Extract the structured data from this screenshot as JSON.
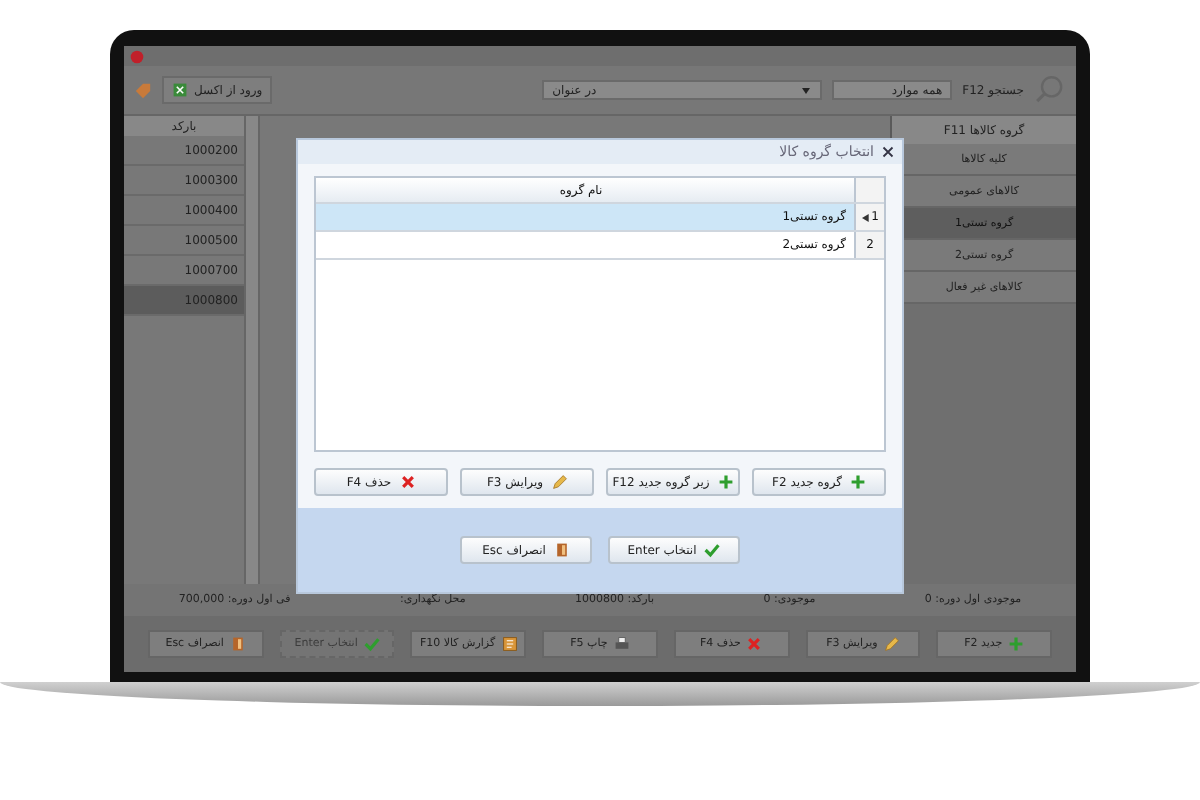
{
  "toolbar": {
    "search_label": "جستجو F12",
    "search_value": "همه موارد",
    "filter_value": "در عنوان",
    "import_button": "ورود از اکسل"
  },
  "sidebar": {
    "title": "گروه کالاها F11",
    "items": [
      {
        "label": "کلیه کالاها",
        "selected": false
      },
      {
        "label": "کالاهای عمومی",
        "selected": false
      },
      {
        "label": "گروه تستی1",
        "selected": true
      },
      {
        "label": "گروه تستی2",
        "selected": false
      },
      {
        "label": "کالاهای غیر فعال",
        "selected": false
      }
    ]
  },
  "table": {
    "columns": [
      "بارکد"
    ],
    "rows": [
      {
        "barcode": "1000200",
        "selected": false
      },
      {
        "barcode": "1000300",
        "selected": false
      },
      {
        "barcode": "1000400",
        "selected": false
      },
      {
        "barcode": "1000500",
        "selected": false
      },
      {
        "barcode": "1000700",
        "selected": false
      },
      {
        "barcode": "1000800",
        "selected": true
      }
    ]
  },
  "status_bar": [
    "موجودی اول دوره: 0",
    "موجودی: 0",
    "بارکد: 1000800",
    "محل نگهداری:",
    "فی اول دوره: 700,000"
  ],
  "buttons": [
    {
      "label": "جدید F2",
      "kind": "plus",
      "disabled": false
    },
    {
      "label": "ویرایش F3",
      "kind": "pencil",
      "disabled": false
    },
    {
      "label": "حذف F4",
      "kind": "cross",
      "disabled": false
    },
    {
      "label": "چاپ F5",
      "kind": "printer",
      "disabled": false
    },
    {
      "label": "گزارش کالا F10",
      "kind": "report",
      "disabled": false
    },
    {
      "label": "انتخاب Enter",
      "kind": "check",
      "disabled": true
    },
    {
      "label": "انصراف Esc",
      "kind": "door",
      "disabled": false
    }
  ],
  "dialog": {
    "title": "انتخاب گروه کالا",
    "column": "نام گروه",
    "rows": [
      {
        "number": "1",
        "name": "گروه تستی1",
        "selected": true
      },
      {
        "number": "2",
        "name": "گروه تستی2",
        "selected": false
      }
    ],
    "buttons": [
      {
        "label": "گروه جدید F2",
        "kind": "plus"
      },
      {
        "label": "زیر گروه جدید F12",
        "kind": "plus"
      },
      {
        "label": "ویرایش F3",
        "kind": "pencil"
      },
      {
        "label": "حذف F4",
        "kind": "cross"
      }
    ],
    "footer_buttons": [
      {
        "label": "انتخاب Enter",
        "kind": "check"
      },
      {
        "label": "انصراف Esc",
        "kind": "door"
      }
    ]
  }
}
